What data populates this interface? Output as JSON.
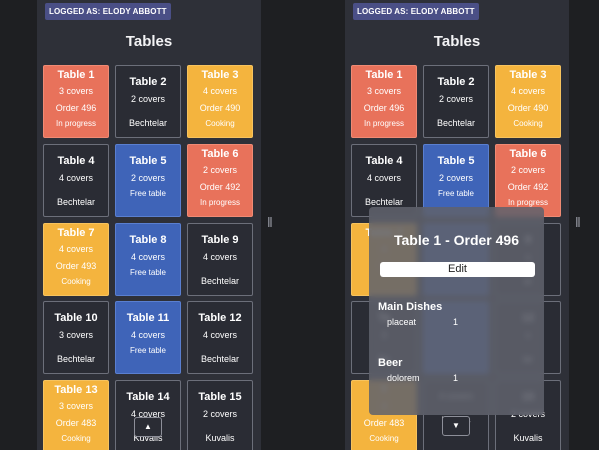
{
  "left": {
    "badge": "LOGGED AS: ELODY ABBOTT",
    "title": "Tables",
    "tables": [
      {
        "name": "Table 1",
        "covers": "3 covers",
        "order": "Order 496",
        "status": "In progress",
        "color": "red"
      },
      {
        "name": "Table 2",
        "covers": "2 covers",
        "waiter": "Bechtelar",
        "color": "dark"
      },
      {
        "name": "Table 3",
        "covers": "4 covers",
        "order": "Order 490",
        "status": "Cooking",
        "color": "yellow"
      },
      {
        "name": "Table 4",
        "covers": "4 covers",
        "waiter": "Bechtelar",
        "color": "dark"
      },
      {
        "name": "Table 5",
        "covers": "2 covers",
        "status": "Free table",
        "color": "blue"
      },
      {
        "name": "Table 6",
        "covers": "2 covers",
        "order": "Order 492",
        "status": "In progress",
        "color": "red"
      },
      {
        "name": "Table 7",
        "covers": "4 covers",
        "order": "Order 493",
        "status": "Cooking",
        "color": "yellow"
      },
      {
        "name": "Table 8",
        "covers": "4 covers",
        "status": "Free table",
        "color": "blue"
      },
      {
        "name": "Table 9",
        "covers": "4 covers",
        "waiter": "Bechtelar",
        "color": "dark"
      },
      {
        "name": "Table 10",
        "covers": "3 covers",
        "waiter": "Bechtelar",
        "color": "dark"
      },
      {
        "name": "Table 11",
        "covers": "4 covers",
        "status": "Free table",
        "color": "blue"
      },
      {
        "name": "Table 12",
        "covers": "4 covers",
        "waiter": "Bechtelar",
        "color": "dark"
      },
      {
        "name": "Table 13",
        "covers": "3 covers",
        "order": "Order 483",
        "status": "Cooking",
        "color": "yellow"
      },
      {
        "name": "Table 14",
        "covers": "4 covers",
        "waiter": "Kuvalis",
        "color": "dark"
      },
      {
        "name": "Table 15",
        "covers": "2 covers",
        "waiter": "Kuvalis",
        "color": "dark"
      }
    ],
    "scroll_up": "▲"
  },
  "right": {
    "badge": "LOGGED AS: ELODY ABBOTT",
    "title": "Tables",
    "tables": [
      {
        "name": "Table 1",
        "covers": "3 covers",
        "order": "Order 496",
        "status": "In progress",
        "color": "red"
      },
      {
        "name": "Table 2",
        "covers": "2 covers",
        "waiter": "Bechtelar",
        "color": "dark"
      },
      {
        "name": "Table 3",
        "covers": "4 covers",
        "order": "Order 490",
        "status": "Cooking",
        "color": "yellow"
      },
      {
        "name": "Table 4",
        "covers": "4 covers",
        "waiter": "Bechtelar",
        "color": "dark"
      },
      {
        "name": "Table 5",
        "covers": "2 covers",
        "status": "Free table",
        "color": "blue"
      },
      {
        "name": "Table 6",
        "covers": "2 covers",
        "order": "Order 492",
        "status": "In progress",
        "color": "red"
      },
      {
        "name": "Table 7",
        "covers": "4",
        "order": "O",
        "status": "",
        "color": "yellow"
      },
      {
        "name": "",
        "covers": "",
        "status": "",
        "color": "blue"
      },
      {
        "name": "9",
        "covers": "s",
        "waiter": "ar",
        "color": "dark"
      },
      {
        "name": "Ta",
        "covers": "3",
        "waiter": "Be",
        "color": "dark"
      },
      {
        "name": "",
        "covers": "",
        "status": "",
        "color": "blue"
      },
      {
        "name": "12",
        "covers": "s",
        "waiter": "lar",
        "color": "dark"
      },
      {
        "name": "T",
        "covers": "3",
        "order": "Order 483",
        "status": "Cooking",
        "color": "yellow"
      },
      {
        "name": "",
        "covers": "4 covers",
        "waiter": "Kuvalis",
        "color": "dark"
      },
      {
        "name": "15",
        "covers": "2 covers",
        "waiter": "Kuvalis",
        "color": "dark"
      }
    ],
    "scroll_down": "▼",
    "popup": {
      "title": "Table 1 - Order 496",
      "edit": "Edit",
      "sections": [
        {
          "name": "Main Dishes",
          "items": [
            {
              "name": "placeat",
              "qty": "1"
            }
          ]
        },
        {
          "name": "Beer",
          "items": [
            {
              "name": "dolorem",
              "qty": "1"
            }
          ]
        }
      ]
    }
  },
  "divider_glyph": "‖"
}
